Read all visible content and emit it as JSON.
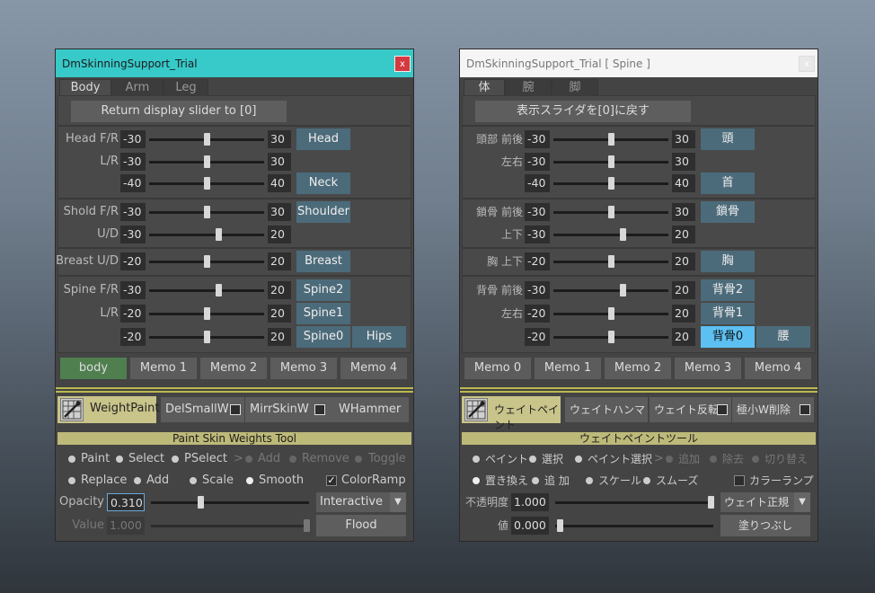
{
  "en": {
    "title": "DmSkinningSupport_Trial",
    "close": "x",
    "tabs": [
      "Body",
      "Arm",
      "Leg"
    ],
    "return_btn": "Return display slider to [0]",
    "rows": [
      {
        "label": "Head F/R",
        "min": "-30",
        "max": "30",
        "value": 0.5
      },
      {
        "label": "L/R",
        "min": "-30",
        "max": "30",
        "value": 0.5
      },
      {
        "label": "",
        "min": "-40",
        "max": "40",
        "value": 0.5
      },
      {
        "label": "Shold F/R",
        "min": "-30",
        "max": "30",
        "value": 0.5
      },
      {
        "label": "U/D",
        "min": "-30",
        "max": "20",
        "value": 0.6
      },
      {
        "label": "Breast U/D",
        "min": "-20",
        "max": "20",
        "value": 0.5
      },
      {
        "label": "Spine F/R",
        "min": "-30",
        "max": "20",
        "value": 0.6
      },
      {
        "label": "L/R",
        "min": "-20",
        "max": "20",
        "value": 0.5
      },
      {
        "label": "",
        "min": "-20",
        "max": "20",
        "value": 0.5
      }
    ],
    "joints": [
      "Head",
      "Neck",
      "Shoulder",
      "Breast",
      "Spine2",
      "Spine1",
      "Spine0",
      "Hips"
    ],
    "memos": [
      "body",
      "Memo 1",
      "Memo 2",
      "Memo 3",
      "Memo 4"
    ],
    "tools": [
      "WeightPaint",
      "DelSmallW",
      "MirrSkinW",
      "WHammer"
    ],
    "paint_title": "Paint Skin Weights Tool",
    "radio_row1": [
      "Paint",
      "Select",
      "PSelect",
      ">",
      "Add",
      "Remove",
      "Toggle"
    ],
    "radio_row2": [
      "Replace",
      "Add",
      "Scale",
      "Smooth"
    ],
    "color_ramp": "ColorRamp",
    "opacity_label": "Opacity",
    "opacity_value": "0.310",
    "opacity_level": 0.31,
    "interactive": "Interactive",
    "value_label": "Value",
    "value_value": "1.000",
    "flood": "Flood"
  },
  "jp": {
    "title": "DmSkinningSupport_Trial    [ Spine ]",
    "close": "x",
    "tabs": [
      "体",
      "腕",
      "脚"
    ],
    "return_btn": "表示スライダを[0]に戻す",
    "rows": [
      {
        "label": "頭部 前後",
        "min": "-30",
        "max": "30",
        "value": 0.5
      },
      {
        "label": "左右",
        "min": "-30",
        "max": "30",
        "value": 0.5
      },
      {
        "label": "",
        "min": "-40",
        "max": "40",
        "value": 0.5
      },
      {
        "label": "鎖骨 前後",
        "min": "-30",
        "max": "30",
        "value": 0.5
      },
      {
        "label": "上下",
        "min": "-30",
        "max": "20",
        "value": 0.6
      },
      {
        "label": "胸 上下",
        "min": "-20",
        "max": "20",
        "value": 0.5
      },
      {
        "label": "背骨 前後",
        "min": "-30",
        "max": "20",
        "value": 0.6
      },
      {
        "label": "左右",
        "min": "-20",
        "max": "20",
        "value": 0.5
      },
      {
        "label": "",
        "min": "-20",
        "max": "20",
        "value": 0.5
      }
    ],
    "joints": [
      "頭",
      "首",
      "鎖骨",
      "胸",
      "背骨2",
      "背骨1",
      "背骨0",
      "腰"
    ],
    "memos": [
      "Memo 0",
      "Memo 1",
      "Memo 2",
      "Memo 3",
      "Memo 4"
    ],
    "tools": [
      "ウェイトペイント",
      "ウェイトハンマー",
      "ウェイト反転",
      "極小W削除"
    ],
    "paint_title": "ウェイトペイントツール",
    "radio_row1": [
      "ペイント",
      "選択",
      "ペイント選択",
      ">",
      "追加",
      "除去",
      "切り替え"
    ],
    "radio_row2": [
      "置き換え",
      "追 加",
      "スケール",
      "スムーズ"
    ],
    "color_ramp": "カラーランプ",
    "opacity_label": "不透明度",
    "opacity_value": "1.000",
    "opacity_level": 1.0,
    "interactive": "ウェイト正規化",
    "value_label": "値",
    "value_value": "0.000",
    "value_level": 0.0,
    "flood": "塗りつぶし"
  }
}
